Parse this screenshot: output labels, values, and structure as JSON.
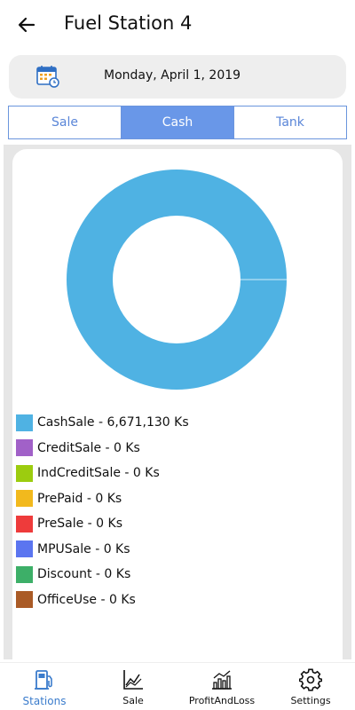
{
  "header": {
    "title": "Fuel Station 4",
    "back_icon": "arrow-left-icon"
  },
  "date_picker": {
    "date": "Monday, April 1, 2019",
    "icon": "calendar-icon"
  },
  "tabs": [
    {
      "label": "Sale",
      "active": false
    },
    {
      "label": "Cash",
      "active": true
    },
    {
      "label": "Tank",
      "active": false
    }
  ],
  "chart_data": {
    "type": "pie",
    "style": "donut",
    "series": [
      {
        "name": "CashSale",
        "value": 6671130,
        "color": "#4fb2e3"
      },
      {
        "name": "CreditSale",
        "value": 0,
        "color": "#a161c8"
      },
      {
        "name": "IndCreditSale",
        "value": 0,
        "color": "#9ccc0f"
      },
      {
        "name": "PrePaid",
        "value": 0,
        "color": "#f2b91d"
      },
      {
        "name": "PreSale",
        "value": 0,
        "color": "#ee3b3b"
      },
      {
        "name": "MPUSale",
        "value": 0,
        "color": "#5b75f0"
      },
      {
        "name": "Discount",
        "value": 0,
        "color": "#3daf68"
      },
      {
        "name": "OfficeUse",
        "value": 0,
        "color": "#aa5b26"
      }
    ]
  },
  "legend": [
    {
      "label": "CashSale - 6,671,130 Ks",
      "color": "#4fb2e3"
    },
    {
      "label": "CreditSale - 0 Ks",
      "color": "#a161c8"
    },
    {
      "label": "IndCreditSale - 0 Ks",
      "color": "#9ccc0f"
    },
    {
      "label": "PrePaid - 0 Ks",
      "color": "#f2b91d"
    },
    {
      "label": "PreSale - 0 Ks",
      "color": "#ee3b3b"
    },
    {
      "label": "MPUSale - 0 Ks",
      "color": "#5b75f0"
    },
    {
      "label": "Discount - 0 Ks",
      "color": "#3daf68"
    },
    {
      "label": "OfficeUse - 0 Ks",
      "color": "#aa5b26"
    }
  ],
  "bottom_nav": [
    {
      "label": "Stations",
      "icon": "fuel-pump-icon",
      "active": true
    },
    {
      "label": "Sale",
      "icon": "line-chart-icon",
      "active": false
    },
    {
      "label": "ProfitAndLoss",
      "icon": "bar-chart-icon",
      "active": false
    },
    {
      "label": "Settings",
      "icon": "gear-icon",
      "active": false
    }
  ],
  "colors": {
    "accent": "#6997e8",
    "active_nav": "#3b7ccc"
  }
}
